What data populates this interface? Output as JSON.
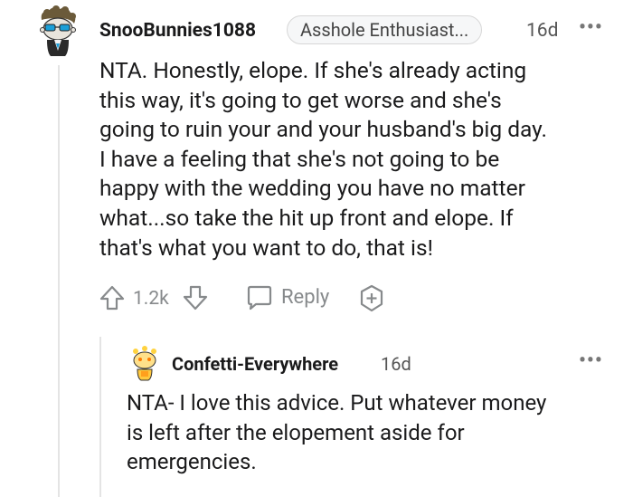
{
  "comment": {
    "username": "SnooBunnies1088",
    "flair": "Asshole Enthusiast...",
    "age": "16d",
    "more_label": "•••",
    "body_lines": [
      "NTA. Honestly, elope. If she's already acting",
      "this way, it's going to get worse and she's",
      "going to ruin your and your husband's big day.",
      "I have a feeling that she's not going to be",
      "happy with the wedding you have no matter",
      "what...so take the hit up front and elope. If",
      "that's what you want to do, that is!"
    ],
    "vote_count": "1.2k",
    "reply_label": "Reply"
  },
  "reply": {
    "username": "Confetti-Everywhere",
    "age": "16d",
    "more_label": "•••",
    "body_lines": [
      "NTA- I love this advice. Put whatever money",
      "is left after the elopement aside for",
      "emergencies."
    ]
  },
  "icons": {
    "upvote": "arrow-up-outline",
    "downvote": "arrow-down-outline",
    "reply": "speech-bubble",
    "award": "plus-circle"
  },
  "colors": {
    "text": "#1a1a1b",
    "muted": "#878a8c",
    "thread_line": "#e4e4e4"
  }
}
